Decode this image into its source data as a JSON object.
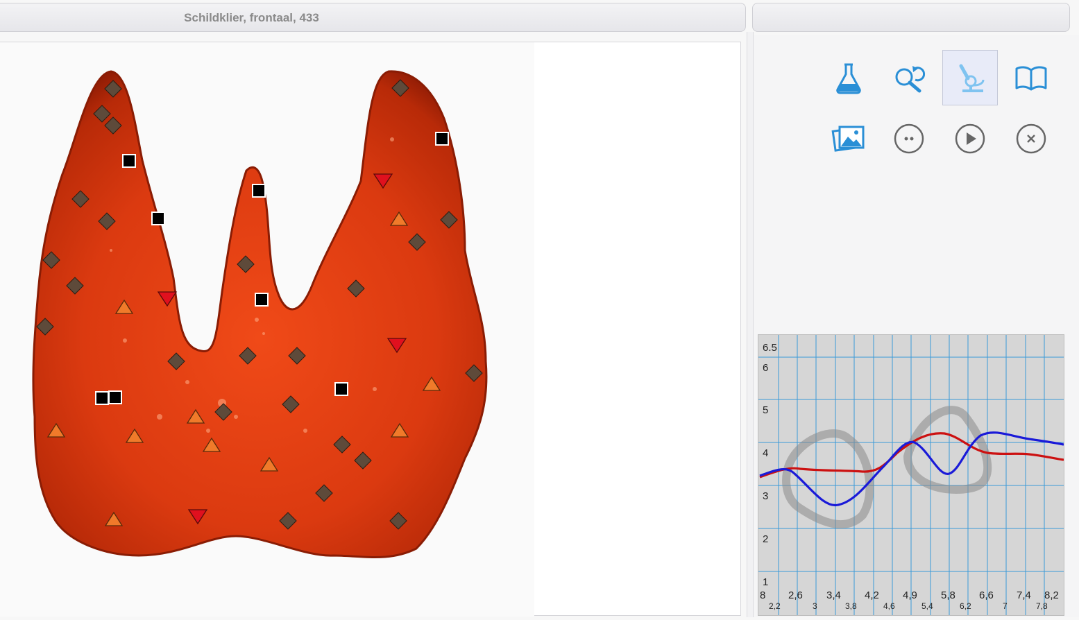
{
  "left_panel": {
    "title": "Schildklier, frontaal, 433"
  },
  "right_panel": {
    "title": ""
  },
  "toolbar": {
    "buttons": [
      {
        "icon": "flask-icon",
        "active": false
      },
      {
        "icon": "search-refresh-icon",
        "active": false
      },
      {
        "icon": "microscope-icon",
        "active": true
      },
      {
        "icon": "book-icon",
        "active": false
      },
      {
        "icon": "image-gallery-icon",
        "active": false
      },
      {
        "icon": "more-icon",
        "active": false
      },
      {
        "icon": "play-icon",
        "active": false
      },
      {
        "icon": "close-icon",
        "active": false
      }
    ]
  },
  "colors": {
    "accent": "#2a8fd6",
    "tissue": "#d93a12",
    "diamond": "#5e4a3a",
    "orange_triangle": "#f07a2a",
    "red_triangle": "#e0101e",
    "square": "#000000",
    "line_red": "#cc1111",
    "line_blue": "#1a1ad8",
    "grid": "#3a9ad8"
  },
  "graph": {
    "y_labels": [
      "6.5",
      "6",
      "5",
      "4",
      "3",
      "2",
      "1"
    ],
    "x_labels_top": [
      "8",
      "2,6",
      "3,4",
      "4,2",
      "4,9",
      "5,8",
      "6,6",
      "7,4",
      "8,2"
    ],
    "x_labels_bottom": [
      "2,2",
      "3",
      "3,8",
      "4,6",
      "5,4",
      "6,2",
      "7",
      "7,8"
    ]
  }
}
